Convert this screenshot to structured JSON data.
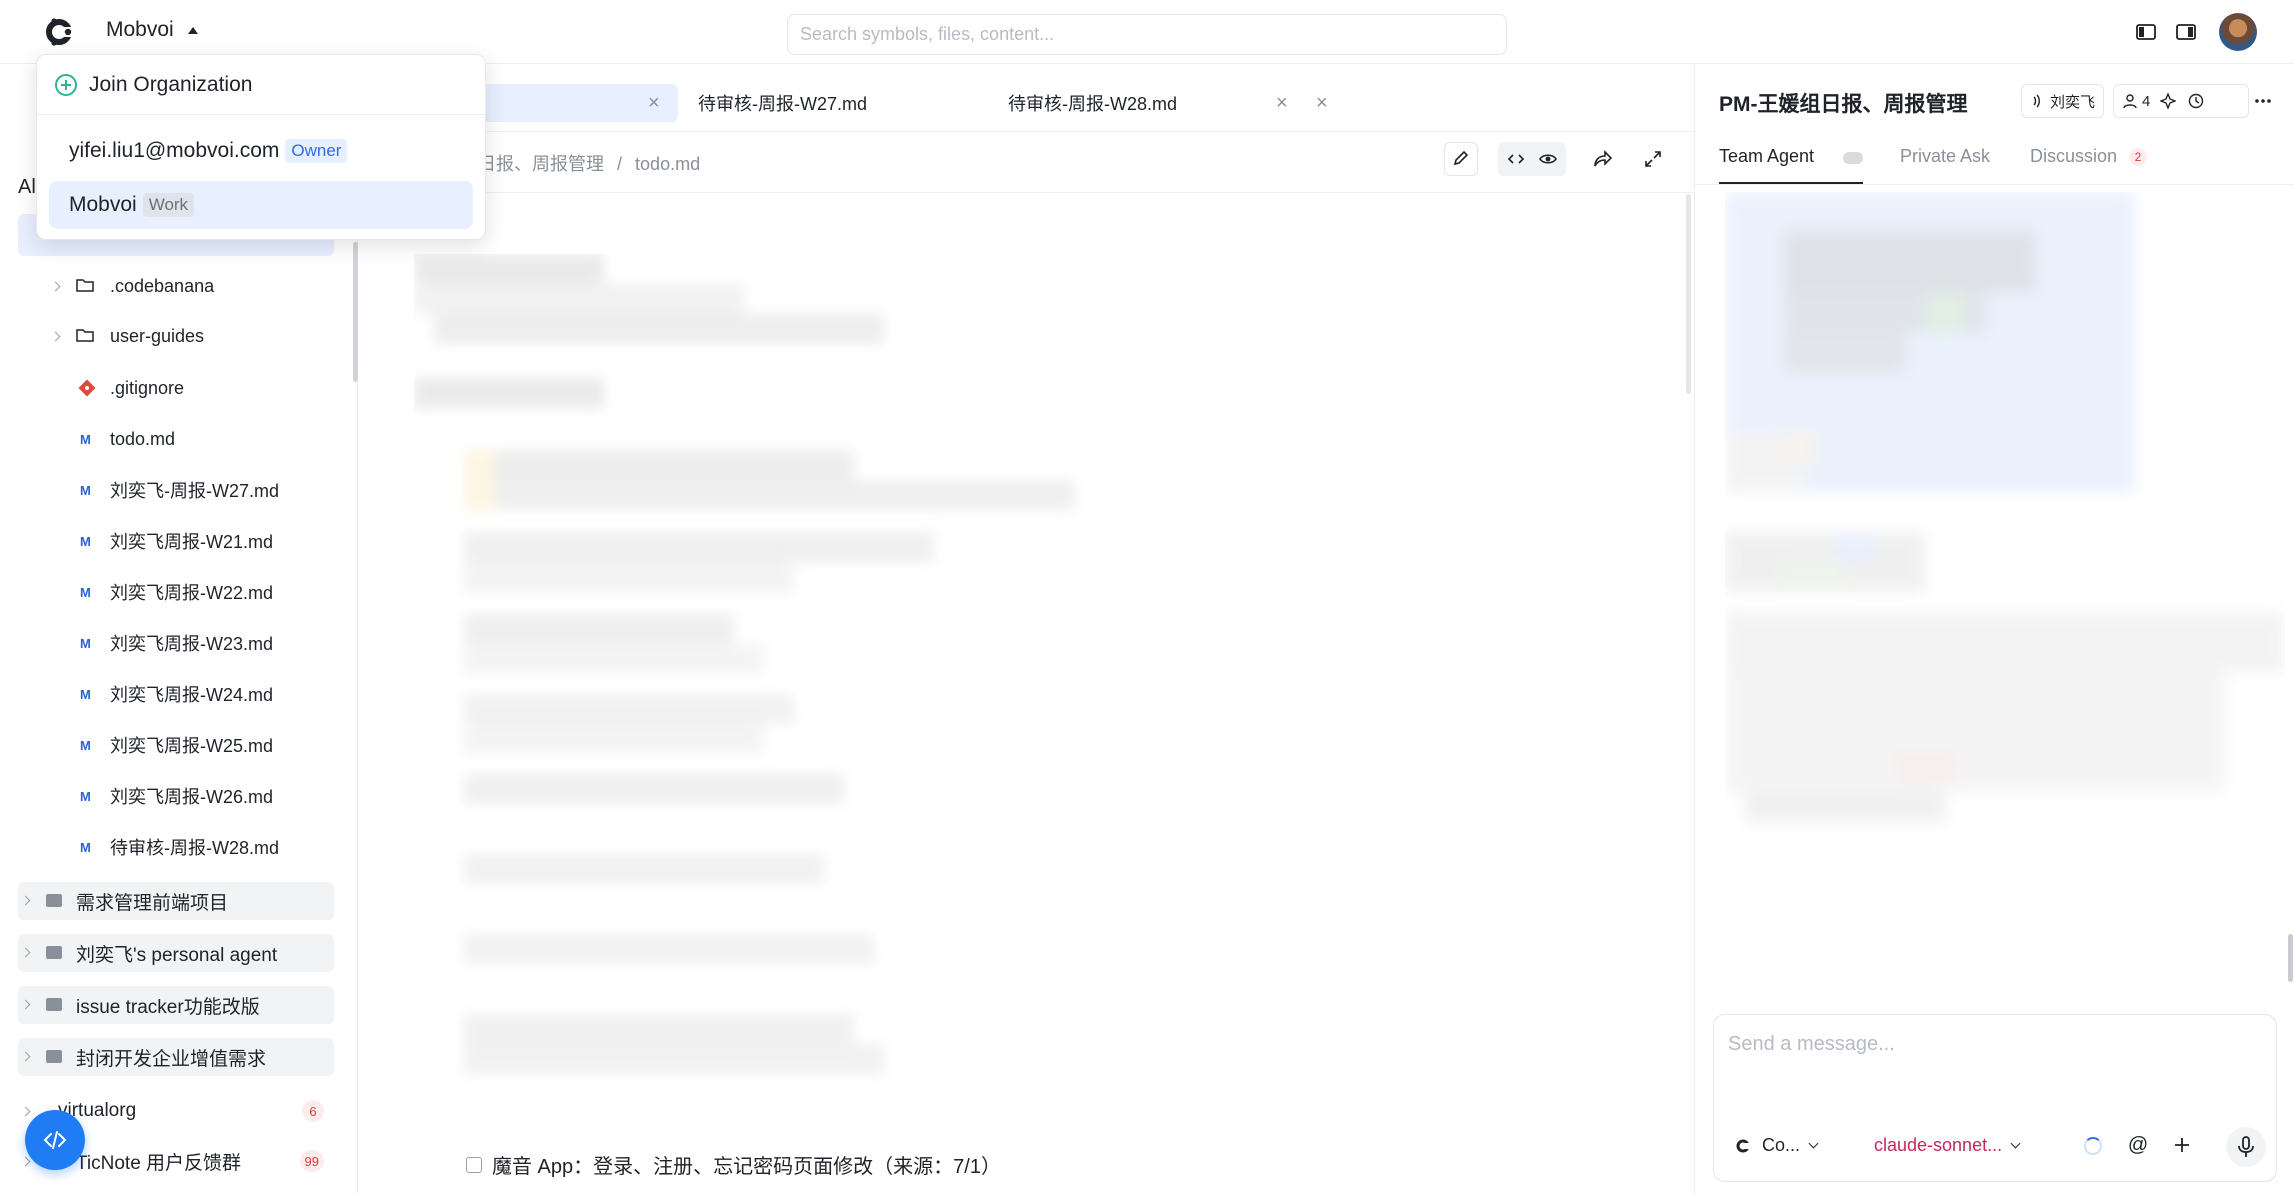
{
  "topbar": {
    "org_name": "Mobvoi",
    "search_placeholder": "Search symbols, files, content..."
  },
  "org_menu": {
    "join_label": "Join Organization",
    "accounts": [
      {
        "name": "yifei.liu1@mobvoi.com",
        "tag": "Owner"
      },
      {
        "name": "Mobvoi",
        "tag": "Work"
      }
    ]
  },
  "sidebar": {
    "section_label": "Al",
    "tree": [
      {
        "label": ".codebanana",
        "kind": "folder"
      },
      {
        "label": "user-guides",
        "kind": "folder"
      },
      {
        "label": ".gitignore",
        "kind": "git"
      },
      {
        "label": "todo.md",
        "kind": "md"
      },
      {
        "label": "刘奕飞-周报-W27.md",
        "kind": "md"
      },
      {
        "label": "刘奕飞周报-W21.md",
        "kind": "md"
      },
      {
        "label": "刘奕飞周报-W22.md",
        "kind": "md"
      },
      {
        "label": "刘奕飞周报-W23.md",
        "kind": "md"
      },
      {
        "label": "刘奕飞周报-W24.md",
        "kind": "md"
      },
      {
        "label": "刘奕飞周报-W25.md",
        "kind": "md"
      },
      {
        "label": "刘奕飞周报-W26.md",
        "kind": "md"
      },
      {
        "label": "待审核-周报-W28.md",
        "kind": "md"
      }
    ],
    "groups": [
      {
        "label": "需求管理前端项目"
      },
      {
        "label": "刘奕飞's personal agent"
      },
      {
        "label": "issue tracker功能改版"
      },
      {
        "label": "封闭开发企业增值需求"
      }
    ],
    "orgs": [
      {
        "label": "virtualorg",
        "badge": "6"
      },
      {
        "label": "TicNote 用户反馈群",
        "badge": "99"
      }
    ]
  },
  "editor": {
    "tabs": [
      {
        "label": "待审核-周报-W27.md"
      },
      {
        "label": "待审核-周报-W28.md"
      }
    ],
    "breadcrumb_part": "日报、周报管理",
    "breadcrumb_sep": "/",
    "breadcrumb_file": "todo.md",
    "bottom_line": "魔音 App：登录、注册、忘记密码页面修改（来源：7/1）"
  },
  "panel": {
    "title": "PM-王媛组日报、周报管理",
    "owner_pill": "刘奕飞",
    "member_count": "4",
    "tabs": {
      "team_agent": "Team Agent",
      "private_ask": "Private Ask",
      "discussion": "Discussion",
      "discussion_badge": "2"
    },
    "composer": {
      "placeholder": "Send a message...",
      "agent_label": "Co...",
      "model_label": "claude-sonnet..."
    }
  },
  "colors": {
    "accent": "#1f7cf5",
    "owner_tag": "#2f6fe0",
    "badge_red": "#e0393e",
    "model_label": "#c1285c"
  }
}
